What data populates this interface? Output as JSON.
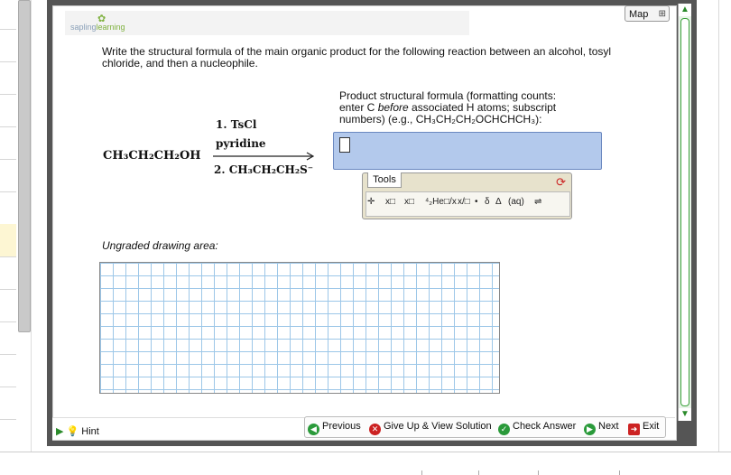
{
  "logo": {
    "brand_a": "sapling",
    "brand_b": "learning"
  },
  "map_button": {
    "label": "Map",
    "icon": "sitemap-icon"
  },
  "question": {
    "text": "Write the structural formula of the main organic product for the following reaction between an alcohol, tosyl chloride, and then a nucleophile."
  },
  "instructions": {
    "line1": "Product structural formula (formatting counts:",
    "line2_a": "enter C ",
    "line2_em": "before",
    "line2_b": " associated H atoms; subscript",
    "line3": "numbers) (e.g., CH₃CH₂CH₂OCHCHCH₃):"
  },
  "reaction": {
    "reactant": "CH₃CH₂CH₂OH",
    "reagent1": "1. TsCl",
    "reagent1b": "pyridine",
    "reagent2": "2. CH₃CH₂CH₂S⁻"
  },
  "answer_input": {
    "value": ""
  },
  "tools": {
    "tab_label": "Tools",
    "buttons": [
      "✛",
      "x□",
      "x□",
      "⁴₂He",
      "□/x",
      "x/□",
      "•",
      "δ",
      "Δ",
      "(aq)",
      "⇌"
    ]
  },
  "ungraded_label": "Ungraded drawing area:",
  "bottom": {
    "hint": "Hint",
    "previous": "Previous",
    "give_up": "Give Up & View Solution",
    "check": "Check Answer",
    "next": "Next",
    "exit": "Exit"
  },
  "colors": {
    "accent_green": "#2a8a2a",
    "answer_bg": "#b3c9ec",
    "grid_line": "#9dc7e8",
    "frame": "#555555"
  }
}
